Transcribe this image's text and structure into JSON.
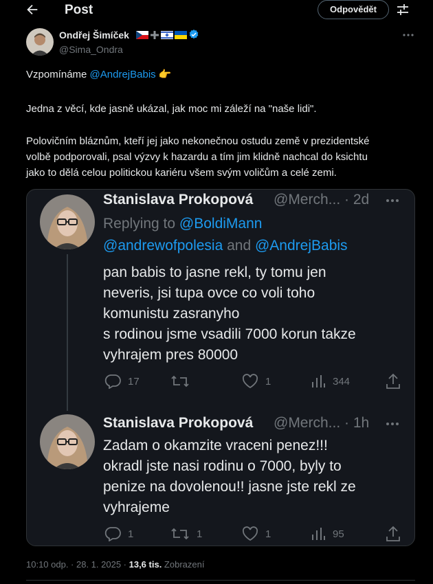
{
  "header": {
    "title": "Post",
    "reply_button": "Odpovědět"
  },
  "author": {
    "name": "Ondřej Šimíček",
    "handle": "@Sima_Ondra",
    "verified": true,
    "flags": [
      "czech-flag",
      "plus-sign",
      "israel-flag",
      "ukraine-flag"
    ]
  },
  "post": {
    "line1_prefix": "Vzpomínáme ",
    "line1_mention": "@AndrejBabis",
    "line1_emoji": "👉",
    "paragraph2": "Jedna z věcí, kde jasně ukázal, jak moc mi záleží na \"naše lidi\".",
    "paragraph3_lines": [
      "Polovičním bláznům, kteří jej jako nekonečnou ostudu země v prezidentské",
      "volbě podporovali, psal výzvy k hazardu a tím jim klidně nachcal do ksichtu",
      "jako to dělá celou politickou kariéru všem svým voličům a celé zemi."
    ]
  },
  "quote": {
    "tweets": [
      {
        "name": "Stanislava Prokopová",
        "meta": "@Merch... · 2d",
        "replying_label": "Replying to",
        "replying_1": "@BoldiMann",
        "replying_2": "@andrewofpolesia",
        "replying_and": " and ",
        "replying_3": "@AndrejBabis",
        "lines": [
          "pan babis to jasne rekl, ty tomu jen",
          "neveris, jsi tupa ovce co voli toho",
          "komunistu zasranyho",
          "s rodinou jsme vsadili 7000 korun takze",
          "vyhrajem pres 80000"
        ],
        "stats": {
          "replies": "17",
          "retweets": "",
          "likes": "1",
          "views": "344"
        }
      },
      {
        "name": "Stanislava Prokopová",
        "meta": "@Merch... · 1h",
        "lines": [
          "Zadam o okamzite vraceni penez!!!",
          "okradl jste nasi rodinu o 7000, byly to",
          "penize na dovolenou!! jasne jste rekl ze",
          "vyhrajeme"
        ],
        "stats": {
          "replies": "1",
          "retweets": "1",
          "likes": "1",
          "views": "95"
        }
      }
    ]
  },
  "footer": {
    "time": "10:10 odp. · 28. 1. 2025 · ",
    "views_count": "13,6 tis.",
    "views_label": " Zobrazení"
  },
  "colors": {
    "background": "#000000",
    "text": "#e7e9ea",
    "secondary": "#71767b",
    "link": "#1d9bf0",
    "verified": "#1d9bf0"
  }
}
